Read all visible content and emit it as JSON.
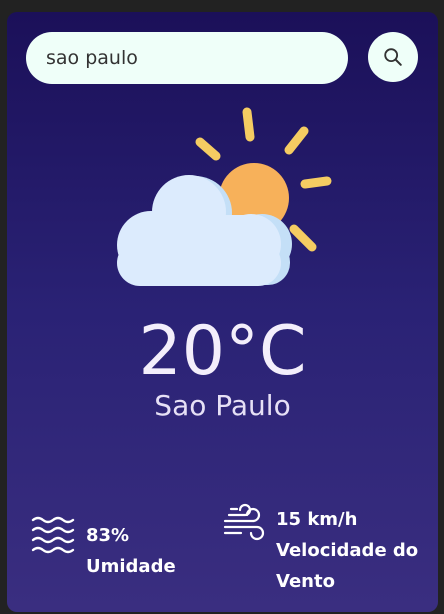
{
  "search": {
    "value": "sao paulo",
    "icon": "search-icon"
  },
  "weather": {
    "icon": "partly-cloudy-icon",
    "temperature": "20°C",
    "city": "Sao Paulo"
  },
  "humidity": {
    "icon": "humidity-waves-icon",
    "value": "83%",
    "label": "Umidade"
  },
  "wind": {
    "icon": "wind-icon",
    "value": "15 km/h",
    "label_line1": "Velocidade do",
    "label_line2": "Vento"
  },
  "colors": {
    "background_top": "#1b1059",
    "background_bottom": "#3a2e80",
    "input_background": "#effff9",
    "sun": "#f7b15a",
    "cloud": "#dcebfd"
  }
}
